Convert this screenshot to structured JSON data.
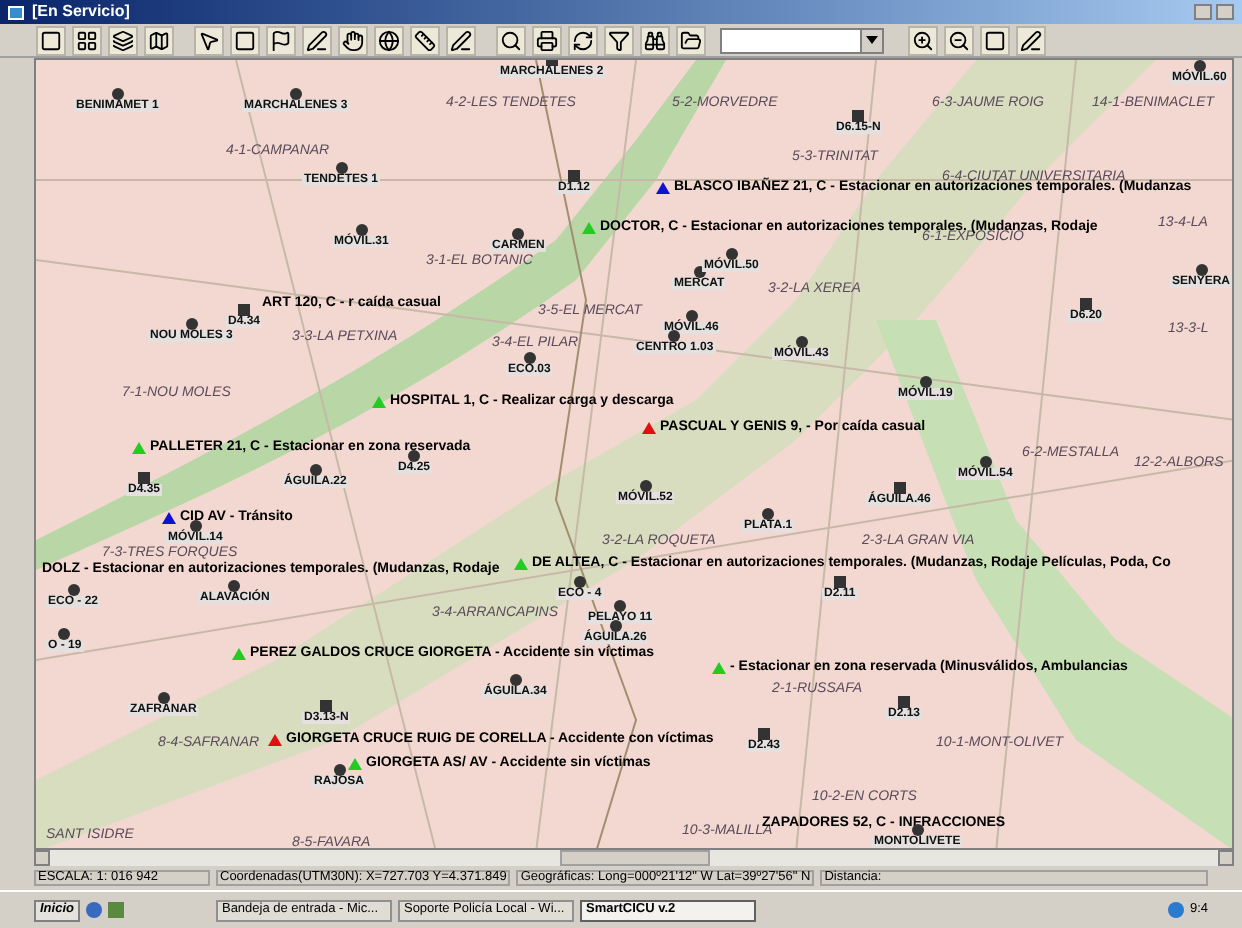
{
  "window": {
    "title": "[En Servicio]"
  },
  "map": {
    "units": [
      {
        "name": "BENIMAMET 1",
        "kind": "dot"
      },
      {
        "name": "MARCHALENES 3",
        "kind": "dot"
      },
      {
        "name": "MARCHALENES 2",
        "kind": "square"
      },
      {
        "name": "TENDETES 1",
        "kind": "dot"
      },
      {
        "name": "MÓVIL.31",
        "kind": "dot"
      },
      {
        "name": "CARMEN",
        "kind": "dot"
      },
      {
        "name": "D1.12",
        "kind": "square"
      },
      {
        "name": "D4.34",
        "kind": "square"
      },
      {
        "name": "NOU MOLES 3",
        "kind": "dot"
      },
      {
        "name": "ECO.03",
        "kind": "dot"
      },
      {
        "name": "MERCAT",
        "kind": "dot"
      },
      {
        "name": "MÓVIL.50",
        "kind": "dot"
      },
      {
        "name": "MÓVIL.46",
        "kind": "dot"
      },
      {
        "name": "CENTRO 1.03",
        "kind": "dot"
      },
      {
        "name": "MÓVIL.43",
        "kind": "dot"
      },
      {
        "name": "MÓVIL.19",
        "kind": "dot"
      },
      {
        "name": "D6.15-N",
        "kind": "square"
      },
      {
        "name": "D6.20",
        "kind": "square"
      },
      {
        "name": "SENYERA",
        "kind": "dot"
      },
      {
        "name": "MÓVIL.60",
        "kind": "dot"
      },
      {
        "name": "D4.35",
        "kind": "square"
      },
      {
        "name": "ÁGUILA.22",
        "kind": "dot"
      },
      {
        "name": "D4.25",
        "kind": "dot"
      },
      {
        "name": "MÓVIL.14",
        "kind": "dot"
      },
      {
        "name": "ALAVACIÓN",
        "kind": "dot"
      },
      {
        "name": "ECO - 22",
        "kind": "dot"
      },
      {
        "name": "O - 19",
        "kind": "dot"
      },
      {
        "name": "ECO - 4",
        "kind": "dot"
      },
      {
        "name": "PELAYO 11",
        "kind": "dot"
      },
      {
        "name": "ÁGUILA.26",
        "kind": "dot"
      },
      {
        "name": "ÁGUILA.34",
        "kind": "dot"
      },
      {
        "name": "D3.13-N",
        "kind": "square"
      },
      {
        "name": "ZAFRANAR",
        "kind": "dot"
      },
      {
        "name": "RAJOSA",
        "kind": "dot"
      },
      {
        "name": "MÓVIL.52",
        "kind": "dot"
      },
      {
        "name": "PLATA.1",
        "kind": "dot"
      },
      {
        "name": "ÁGUILA.46",
        "kind": "square"
      },
      {
        "name": "MÓVIL.54",
        "kind": "dot"
      },
      {
        "name": "D2.11",
        "kind": "square"
      },
      {
        "name": "D2.13",
        "kind": "square"
      },
      {
        "name": "D2.43",
        "kind": "square"
      },
      {
        "name": "MONTOLIVETE",
        "kind": "dot"
      }
    ],
    "districts": [
      "4-2-LES TENDETES",
      "5-2-MORVEDRE",
      "6-3-JAUME ROIG",
      "14-1-BENIMACLET",
      "4-1-CAMPANAR",
      "5-3-TRINITAT",
      "6-4-CIUTAT UNIVERSITARIA",
      "13-4-LA",
      "6-1-EXPOSICIO",
      "3-1-EL BOTANIC",
      "3-2-LA XEREA",
      "3-5-EL MERCAT",
      "13-3-L",
      "3-3-LA PETXINA",
      "3-4-EL PILAR",
      "7-1-NOU MOLES",
      "6-2-MESTALLA",
      "12-2-ALBORS",
      "3-2-LA ROQUETA",
      "2-3-LA GRAN VIA",
      "7-3-TRES FORQUES",
      "3-4-ARRANCAPINS",
      "2-1-RUSSAFA",
      "8-4-SAFRANAR",
      "10-1-MONT-OLIVET",
      "10-2-EN CORTS",
      "10-3-MALILLA",
      "8-5-FAVARA",
      "SANT ISIDRE"
    ],
    "incidents": [
      {
        "text": "ART 120, C - r caída casual"
      },
      {
        "text": "HOSPITAL 1, C - Realizar carga y descarga",
        "color": "#22cc22"
      },
      {
        "text": "BLASCO IBAÑEZ 21, C - Estacionar en autorizaciones temporales. (Mudanzas",
        "color": "#1010d0"
      },
      {
        "text": "DOCTOR, C - Estacionar en autorizaciones temporales. (Mudanzas, Rodaje",
        "color": "#22cc22"
      },
      {
        "text": "PASCUAL Y GENIS 9, - Por caída casual",
        "color": "#e01010"
      },
      {
        "text": "PALLETER 21, C - Estacionar en zona reservada",
        "color": "#22cc22"
      },
      {
        "text": "CID AV - Tránsito",
        "color": "#1010d0"
      },
      {
        "text": "DOLZ - Estacionar en autorizaciones temporales. (Mudanzas, Rodaje"
      },
      {
        "text": "DE ALTEA, C - Estacionar en autorizaciones temporales. (Mudanzas, Rodaje Películas, Poda, Co",
        "color": "#22cc22"
      },
      {
        "text": "PEREZ GALDOS CRUCE GIORGETA - Accidente sin víctimas",
        "color": "#22cc22"
      },
      {
        "text": "- Estacionar en zona reservada (Minusválidos, Ambulancias",
        "color": "#22cc22"
      },
      {
        "text": "GIORGETA CRUCE RUIG DE CORELLA - Accidente con víctimas",
        "color": "#e01010"
      },
      {
        "text": "GIORGETA AS/ AV - Accidente sin víctimas",
        "color": "#22cc22"
      },
      {
        "text": "ZAPADORES 52, C - INFRACCIONES"
      }
    ]
  },
  "status_bar": {
    "scale": "ESCALA: 1: 016 942",
    "coordinates": "Coordenadas(UTM30N): X=727.703 Y=4.371.849",
    "geographic": "Geográficas: Long=000º21'12\" W Lat=39º27'56\" N",
    "distance": "Distancia:"
  },
  "taskbar": {
    "start": "Inicio",
    "tasks": [
      {
        "label": "Bandeja de entrada - Mic...",
        "selected": false
      },
      {
        "label": "Soporte Policía Local - Wi...",
        "selected": false
      },
      {
        "label": "SmartCICU v.2",
        "selected": true
      }
    ],
    "clock": "9:4"
  }
}
